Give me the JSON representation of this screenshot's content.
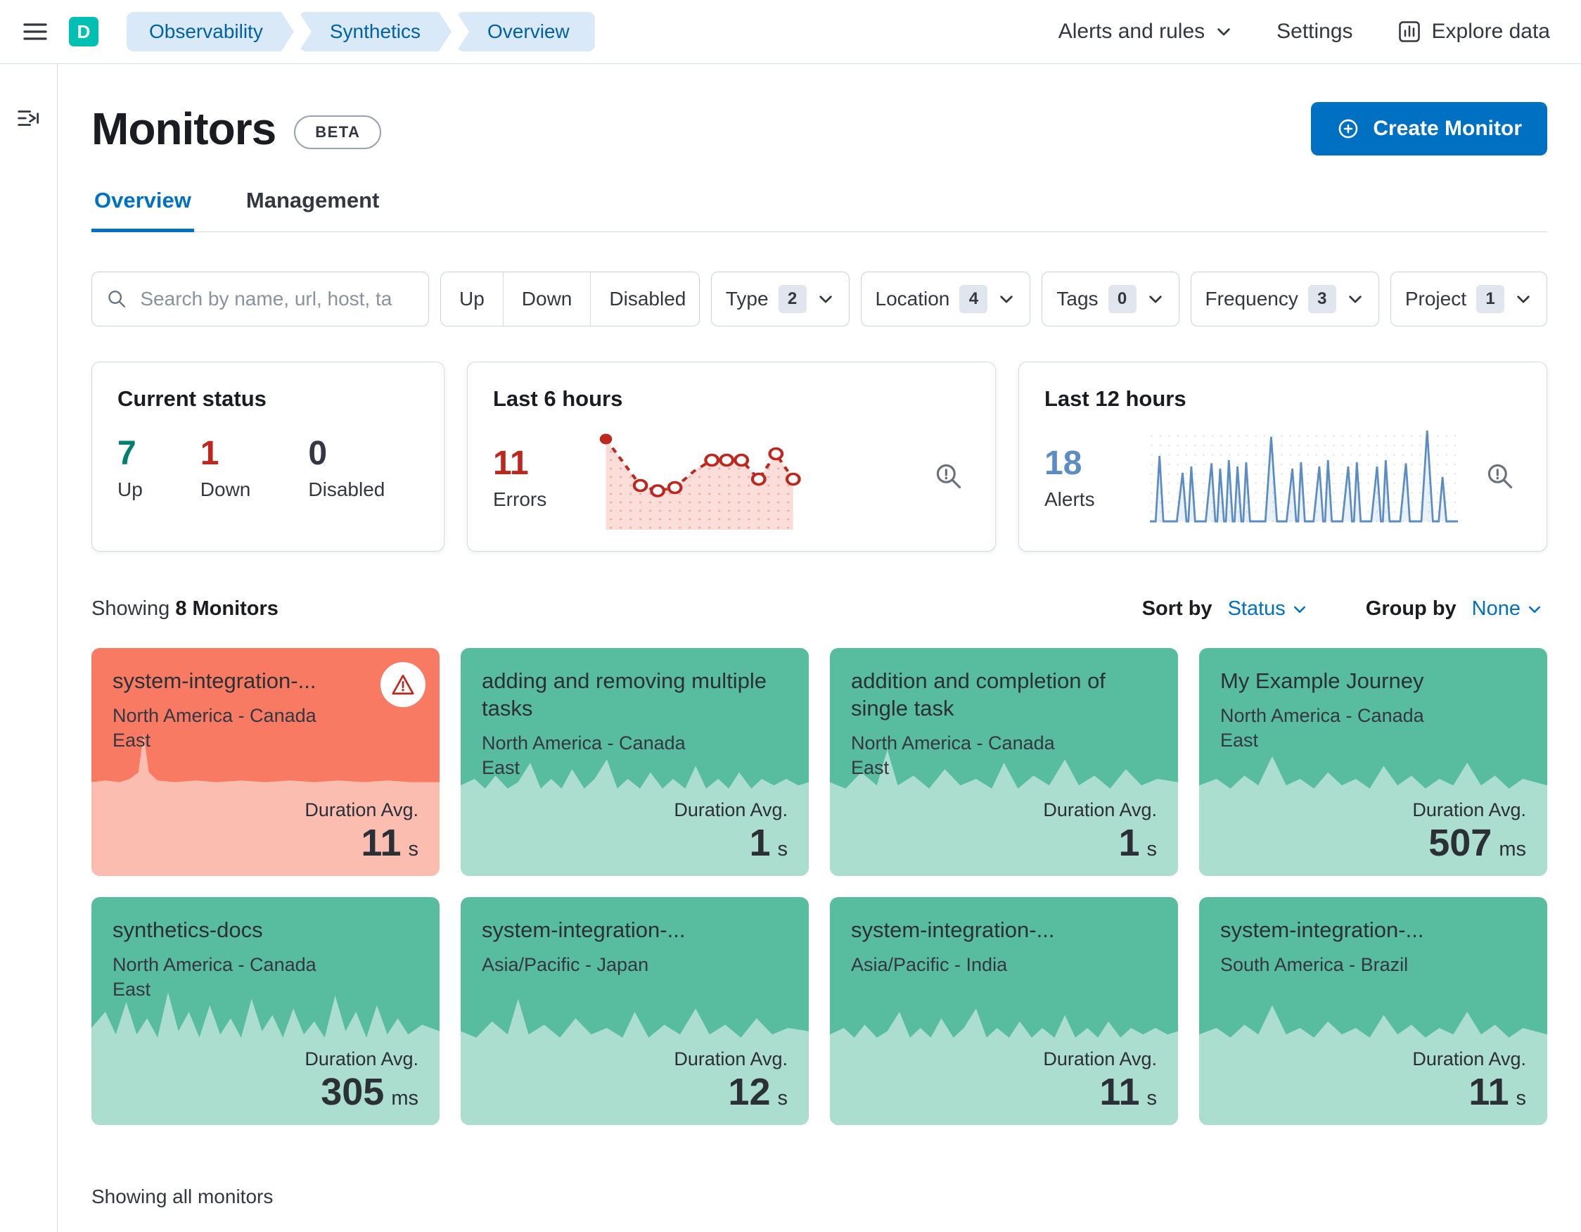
{
  "topbar": {
    "deployment_letter": "D",
    "breadcrumbs": [
      "Observability",
      "Synthetics",
      "Overview"
    ],
    "alerts_and_rules": "Alerts and rules",
    "settings": "Settings",
    "explore_data": "Explore data"
  },
  "header": {
    "title": "Monitors",
    "beta_badge": "BETA",
    "create_button": "Create Monitor"
  },
  "tabs": {
    "overview": "Overview",
    "management": "Management"
  },
  "filters": {
    "search_placeholder": "Search by name, url, host, ta",
    "up": "Up",
    "down": "Down",
    "disabled": "Disabled",
    "dropdowns": [
      {
        "label": "Type",
        "count": "2"
      },
      {
        "label": "Location",
        "count": "4"
      },
      {
        "label": "Tags",
        "count": "0"
      },
      {
        "label": "Frequency",
        "count": "3"
      },
      {
        "label": "Project",
        "count": "1"
      }
    ]
  },
  "stats": {
    "current_status": {
      "title": "Current status",
      "up_value": "7",
      "up_label": "Up",
      "down_value": "1",
      "down_label": "Down",
      "disabled_value": "0",
      "disabled_label": "Disabled"
    },
    "last_6_hours": {
      "title": "Last 6 hours",
      "value": "11",
      "label": "Errors"
    },
    "last_12_hours": {
      "title": "Last 12 hours",
      "value": "18",
      "label": "Alerts"
    }
  },
  "listbar": {
    "showing_prefix": "Showing",
    "showing_count": "8 Monitors",
    "sort_label": "Sort by",
    "sort_value": "Status",
    "group_label": "Group by",
    "group_value": "None"
  },
  "labels": {
    "duration": "Duration Avg."
  },
  "monitors": [
    {
      "name": "system-integration-...",
      "location": "North America - Canada East",
      "value": "11",
      "unit": "s",
      "status": "down"
    },
    {
      "name": "adding and removing multiple tasks",
      "location": "North America - Canada East",
      "value": "1",
      "unit": "s",
      "status": "up"
    },
    {
      "name": "addition and completion of single task",
      "location": "North America - Canada East",
      "value": "1",
      "unit": "s",
      "status": "up"
    },
    {
      "name": "My Example Journey",
      "location": "North America - Canada East",
      "value": "507",
      "unit": "ms",
      "status": "up"
    },
    {
      "name": "synthetics-docs",
      "location": "North America - Canada East",
      "value": "305",
      "unit": "ms",
      "status": "up"
    },
    {
      "name": "system-integration-...",
      "location": "Asia/Pacific - Japan",
      "value": "12",
      "unit": "s",
      "status": "up"
    },
    {
      "name": "system-integration-...",
      "location": "Asia/Pacific - India",
      "value": "11",
      "unit": "s",
      "status": "up"
    },
    {
      "name": "system-integration-...",
      "location": "South America - Brazil",
      "value": "11",
      "unit": "s",
      "status": "up"
    }
  ],
  "footer": {
    "text": "Showing all monitors"
  },
  "colors": {
    "accent_blue": "#0071c2",
    "brand_teal": "#00bfb3",
    "success_green": "#017d73",
    "danger_red": "#bd271e",
    "alerts_blue": "#5b8cc4",
    "card_up_green": "#58bd9f",
    "card_down_red": "#f97a62"
  }
}
